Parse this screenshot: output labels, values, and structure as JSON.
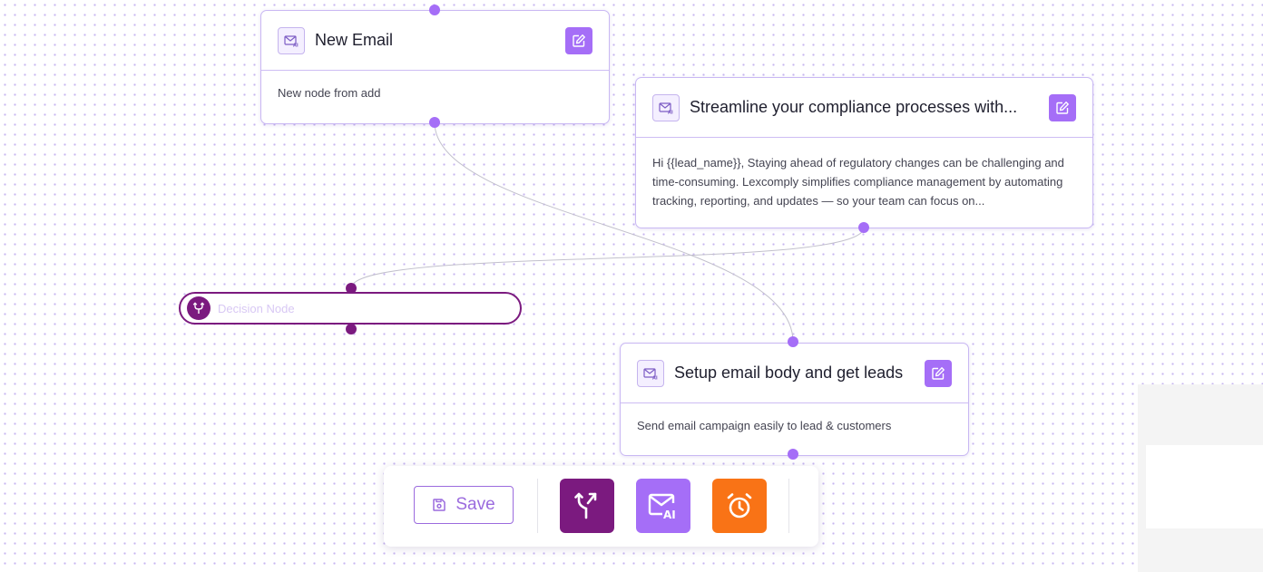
{
  "nodes": {
    "new_email": {
      "title": "New Email",
      "body": "New node from add"
    },
    "compliance": {
      "title": "Streamline your compliance processes with...",
      "body": "Hi {{lead_name}}, Staying ahead of regulatory changes can be challenging and time-consuming. Lexcomply simplifies compliance management by automating tracking, reporting, and updates — so your team can focus on..."
    },
    "setup": {
      "title": "Setup email body and get leads",
      "body": "Send email campaign easily to lead & customers"
    },
    "decision": {
      "label": "Decision Node"
    }
  },
  "toolbar": {
    "save_label": "Save",
    "tools": [
      {
        "name": "decision-tool",
        "icon": "split-arrow-icon",
        "color": "#7b1a7f"
      },
      {
        "name": "ai-email-tool",
        "icon": "mail-ai-icon",
        "color": "#a56ef7"
      },
      {
        "name": "delay-tool",
        "icon": "alarm-clock-icon",
        "color": "#f97316"
      }
    ]
  },
  "colors": {
    "accent": "#a56ef7",
    "decision": "#7b1a7f",
    "delay": "#f97316",
    "save": "#9b6bde"
  }
}
